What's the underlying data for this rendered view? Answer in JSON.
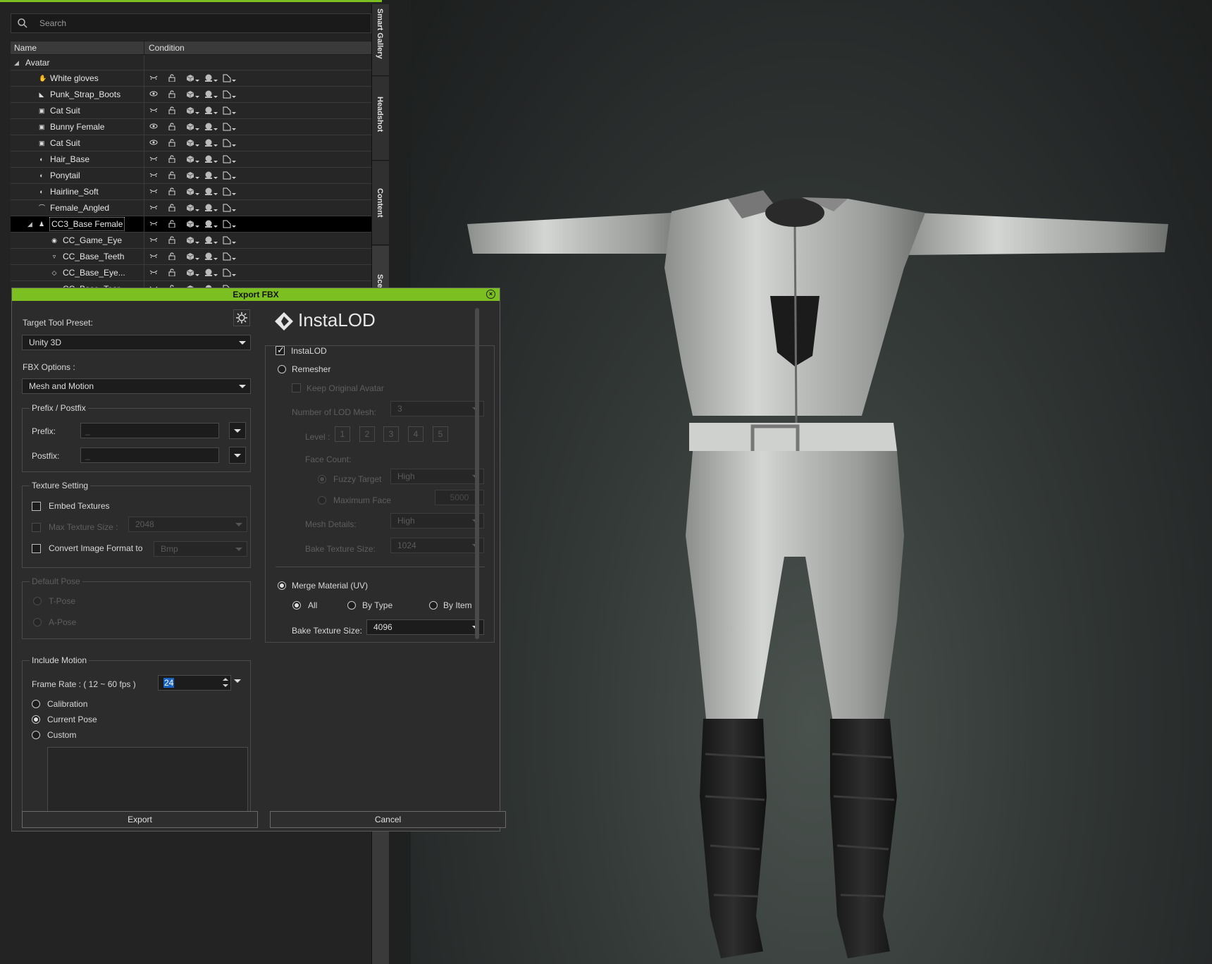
{
  "search": {
    "placeholder": "Search"
  },
  "tree": {
    "columns": {
      "name": "Name",
      "condition": "Condition"
    },
    "root": "Avatar",
    "rows": [
      {
        "label": "White gloves",
        "icon": "glove-icon",
        "visible": false
      },
      {
        "label": "Punk_Strap_Boots",
        "icon": "boot-icon",
        "visible": true
      },
      {
        "label": "Cat Suit",
        "icon": "shirt-icon",
        "visible": false
      },
      {
        "label": "Bunny Female",
        "icon": "shirt-icon",
        "visible": true
      },
      {
        "label": "Cat Suit",
        "icon": "shirt-icon",
        "visible": true
      },
      {
        "label": "Hair_Base",
        "icon": "hair-icon",
        "visible": false
      },
      {
        "label": "Ponytail",
        "icon": "hair-icon",
        "visible": false
      },
      {
        "label": "Hairline_Soft",
        "icon": "hair-icon",
        "visible": false
      },
      {
        "label": "Female_Angled",
        "icon": "eyebrow-icon",
        "visible": false
      },
      {
        "label": "CC3_Base Female",
        "icon": "person-icon",
        "visible": false,
        "selected": true
      },
      {
        "label": "CC_Game_Eye",
        "icon": "eye-icon",
        "visible": false,
        "child": true
      },
      {
        "label": "CC_Base_Teeth",
        "icon": "teeth-icon",
        "visible": false,
        "child": true
      },
      {
        "label": "CC_Base_Eye...",
        "icon": "eye-occlusion-icon",
        "visible": false,
        "child": true
      },
      {
        "label": "CC_Base_Tear...",
        "icon": "tear-icon",
        "visible": false,
        "child": true
      }
    ]
  },
  "side_tabs": [
    "Smart Gallery",
    "Headshot",
    "Content",
    "Scene"
  ],
  "dialog": {
    "title": "Export FBX",
    "target_preset_label": "Target Tool Preset:",
    "target_preset_value": "Unity 3D",
    "fbx_options_label": "FBX Options :",
    "fbx_options_value": "Mesh and Motion",
    "prefix_group": "Prefix / Postfix",
    "prefix_label": "Prefix:",
    "postfix_label": "Postfix:",
    "prefix_value": "_",
    "postfix_value": "_",
    "texture_group": "Texture Setting",
    "embed_textures": "Embed Textures",
    "max_texture_size_label": "Max Texture Size :",
    "max_texture_size_value": "2048",
    "convert_image_label": "Convert Image Format to",
    "convert_image_value": "Bmp",
    "default_pose_group": "Default Pose",
    "t_pose": "T-Pose",
    "a_pose": "A-Pose",
    "include_motion_group": "Include Motion",
    "frame_rate_label": "Frame Rate : ( 12 ~ 60 fps )",
    "frame_rate_value": "24",
    "calibration": "Calibration",
    "current_pose": "Current Pose",
    "custom": "Custom",
    "export_button": "Export",
    "cancel_button": "Cancel",
    "instalod": {
      "logo_text": "InstaLOD",
      "enable_label": "InstaLOD",
      "remesher": "Remesher",
      "keep_original": "Keep Original Avatar",
      "num_lod_label": "Number of LOD Mesh:",
      "num_lod_value": "3",
      "level_label": "Level :",
      "levels": [
        "1",
        "2",
        "3",
        "4",
        "5"
      ],
      "face_count_label": "Face Count:",
      "fuzzy_target": "Fuzzy Target",
      "fuzzy_target_value": "High",
      "maximum_face": "Maximum Face",
      "maximum_face_value": "5000",
      "mesh_details_label": "Mesh Details:",
      "mesh_details_value": "High",
      "bake_texture_label_disabled": "Bake Texture Size:",
      "bake_texture_value_disabled": "1024",
      "merge_material": "Merge Material (UV)",
      "all": "All",
      "by_type": "By Type",
      "by_item": "By Item",
      "bake_texture_label": "Bake Texture Size:",
      "bake_texture_value": "4096"
    }
  },
  "colors": {
    "accent": "#7bbf21",
    "selection": "#1a63c2"
  }
}
